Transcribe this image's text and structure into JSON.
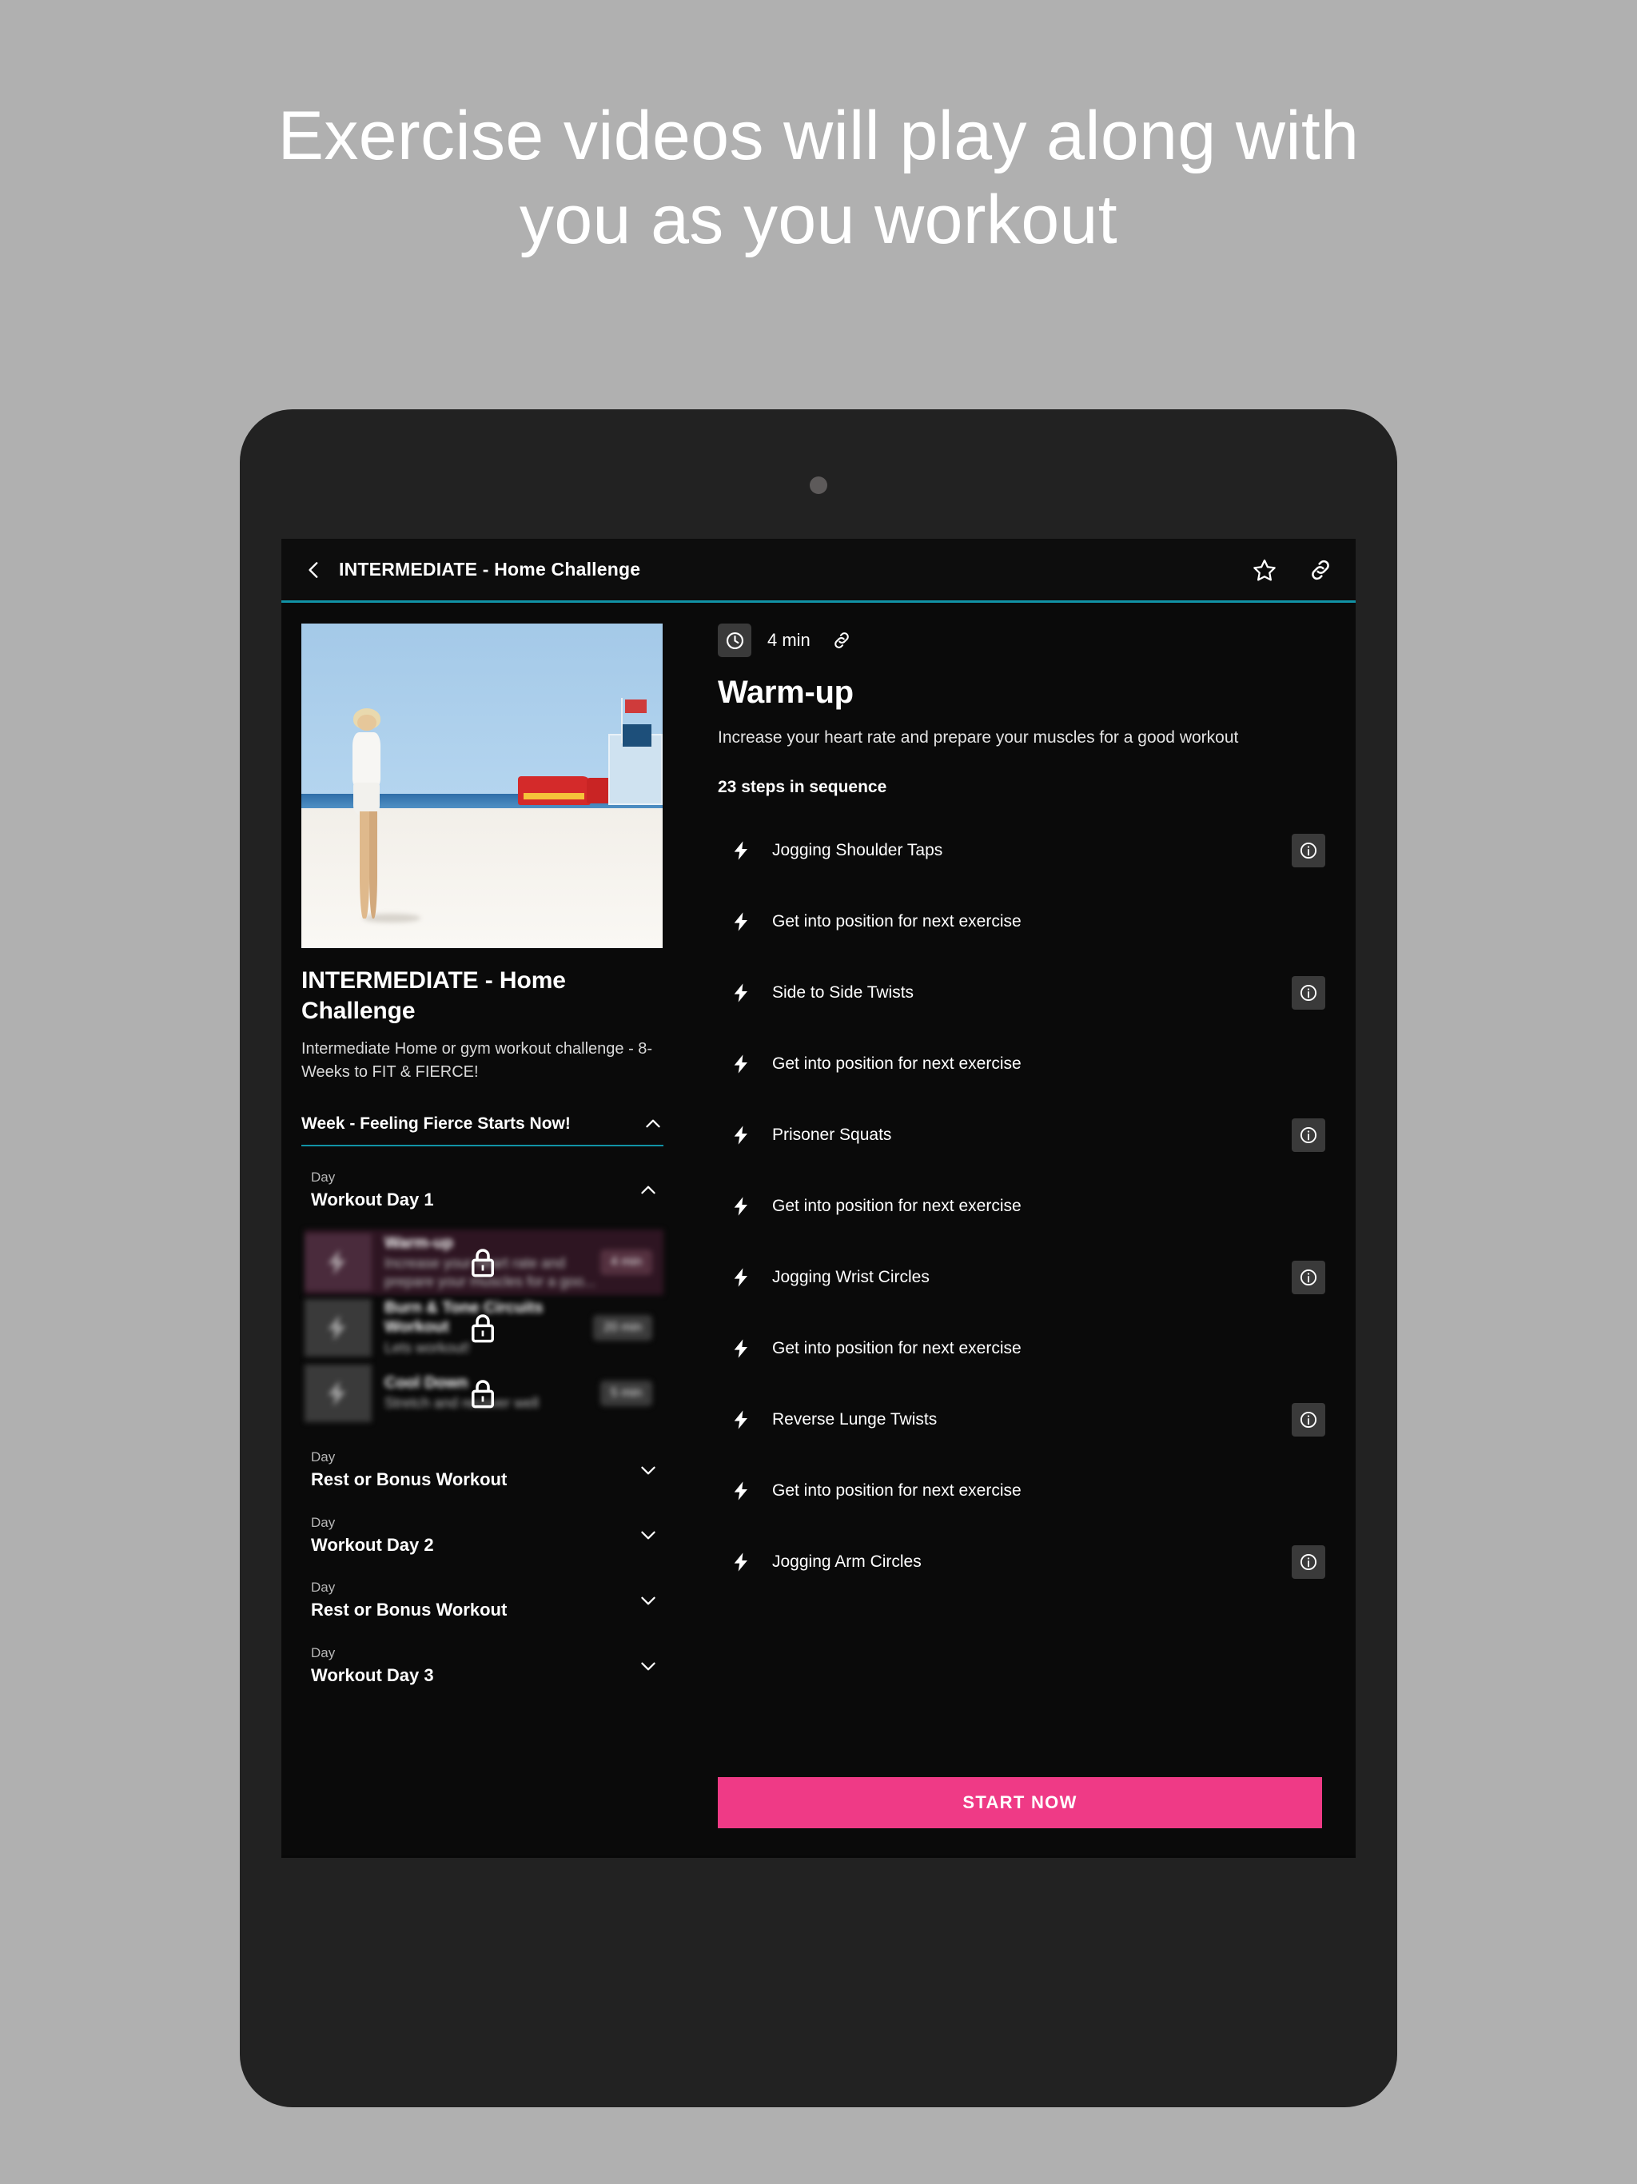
{
  "promo": {
    "headline": "Exercise videos will play along with you as you workout"
  },
  "colors": {
    "page_background": "#b0b0b0",
    "device_frame": "#222222",
    "screen_background": "#0a0a0a",
    "accent_teal": "#1193a6",
    "accent_pink": "#ef3a86",
    "active_card": "#2e1522"
  },
  "appbar": {
    "back_icon": "chevron-left-icon",
    "title": "INTERMEDIATE - Home Challenge",
    "favorite_icon": "star-icon",
    "share_icon": "link-icon"
  },
  "sidebar": {
    "hero_image_alt": "woman on beach with lifeguard trucks",
    "title": "INTERMEDIATE - Home Challenge",
    "description": "Intermediate Home or gym workout challenge - 8-Weeks to FIT & FIERCE!",
    "week": {
      "label": "Week - Feeling Fierce Starts Now!",
      "expanded": true,
      "chevron": "chevron-up-icon"
    },
    "days": [
      {
        "kicker": "Day",
        "name": "Workout Day 1",
        "expanded": true,
        "chevron": "chevron-up-icon",
        "workouts": [
          {
            "name": "Warm-up",
            "sub": "Increase your heart rate and prepare your muscles for a goo...",
            "duration": "4 min",
            "locked": true,
            "active": true
          },
          {
            "name": "Burn & Tone Circuits Workout",
            "sub": "Lets workout!",
            "duration": "20 min",
            "locked": true,
            "active": false
          },
          {
            "name": "Cool Down",
            "sub": "Stretch and recover well",
            "duration": "5 min",
            "locked": true,
            "active": false
          }
        ]
      },
      {
        "kicker": "Day",
        "name": "Rest or Bonus Workout",
        "expanded": false,
        "chevron": "chevron-down-icon",
        "workouts": []
      },
      {
        "kicker": "Day",
        "name": "Workout Day 2",
        "expanded": false,
        "chevron": "chevron-down-icon",
        "workouts": []
      },
      {
        "kicker": "Day",
        "name": "Rest or Bonus Workout",
        "expanded": false,
        "chevron": "chevron-down-icon",
        "workouts": []
      },
      {
        "kicker": "Day",
        "name": "Workout Day 3",
        "expanded": false,
        "chevron": "chevron-down-icon",
        "workouts": []
      }
    ]
  },
  "panel": {
    "duration_icon": "clock-icon",
    "duration": "4 min",
    "share_icon": "link-icon",
    "title": "Warm-up",
    "description": "Increase your heart rate and prepare your muscles for a good workout",
    "steps_label": "23 steps in sequence",
    "steps": [
      {
        "name": "Jogging Shoulder Taps",
        "icon": "bolt-icon",
        "has_info": true
      },
      {
        "name": "Get into position for next exercise",
        "icon": "bolt-icon",
        "has_info": false
      },
      {
        "name": "Side to Side Twists",
        "icon": "bolt-icon",
        "has_info": true
      },
      {
        "name": "Get into position for next exercise",
        "icon": "bolt-icon",
        "has_info": false
      },
      {
        "name": "Prisoner Squats",
        "icon": "bolt-icon",
        "has_info": true
      },
      {
        "name": "Get into position for next exercise",
        "icon": "bolt-icon",
        "has_info": false
      },
      {
        "name": "Jogging Wrist Circles",
        "icon": "bolt-icon",
        "has_info": true
      },
      {
        "name": "Get into position for next exercise",
        "icon": "bolt-icon",
        "has_info": false
      },
      {
        "name": "Reverse Lunge Twists",
        "icon": "bolt-icon",
        "has_info": true
      },
      {
        "name": "Get into position for next exercise",
        "icon": "bolt-icon",
        "has_info": false
      },
      {
        "name": "Jogging Arm Circles",
        "icon": "bolt-icon",
        "has_info": true
      }
    ],
    "start_button": "START NOW"
  }
}
